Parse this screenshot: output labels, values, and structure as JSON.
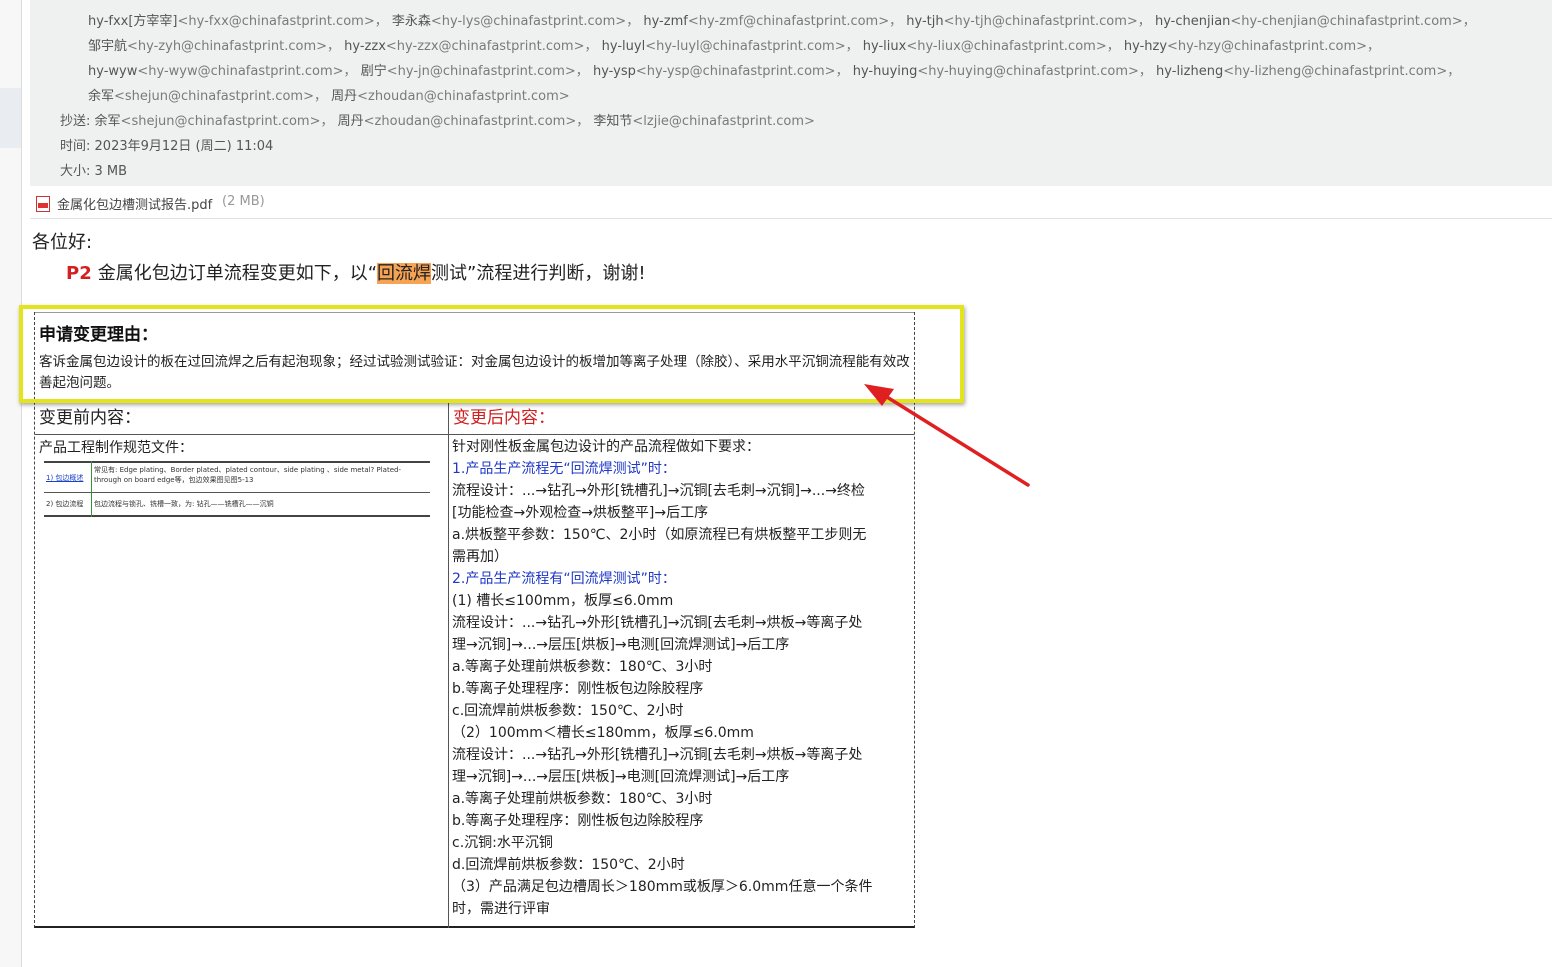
{
  "header": {
    "to_lines": [
      [
        {
          "name": "hy-fxx[方宰宰]",
          "email": "<hy-fxx@chinafastprint.com>，"
        },
        {
          "name": "李永森",
          "email": "<hy-lys@chinafastprint.com>，"
        },
        {
          "name": "hy-zmf",
          "email": "<hy-zmf@chinafastprint.com>，"
        },
        {
          "name": "hy-tjh",
          "email": "<hy-tjh@chinafastprint.com>，"
        },
        {
          "name": "hy-chenjian",
          "email": "<hy-chenjian@chinafastprint.com>，"
        }
      ],
      [
        {
          "name": "邹宇航",
          "email": "<hy-zyh@chinafastprint.com>，"
        },
        {
          "name": "hy-zzx",
          "email": "<hy-zzx@chinafastprint.com>，"
        },
        {
          "name": "hy-luyl",
          "email": "<hy-luyl@chinafastprint.com>，"
        },
        {
          "name": "hy-liux",
          "email": "<hy-liux@chinafastprint.com>，"
        },
        {
          "name": "hy-hzy",
          "email": "<hy-hzy@chinafastprint.com>，"
        }
      ],
      [
        {
          "name": "hy-wyw",
          "email": "<hy-wyw@chinafastprint.com>，"
        },
        {
          "name": "剧宁",
          "email": "<hy-jn@chinafastprint.com>，"
        },
        {
          "name": "hy-ysp",
          "email": "<hy-ysp@chinafastprint.com>，"
        },
        {
          "name": "hy-huying",
          "email": "<hy-huying@chinafastprint.com>，"
        },
        {
          "name": "hy-lizheng",
          "email": "<hy-lizheng@chinafastprint.com>，"
        }
      ],
      [
        {
          "name": "余军",
          "email": "<shejun@chinafastprint.com>，"
        },
        {
          "name": "周丹",
          "email": "<zhoudan@chinafastprint.com>"
        }
      ]
    ],
    "cc_label": "抄送:",
    "cc": [
      {
        "name": "余军",
        "email": "<shejun@chinafastprint.com>，"
      },
      {
        "name": "周丹",
        "email": "<zhoudan@chinafastprint.com>，"
      },
      {
        "name": "李知节",
        "email": "<lzjie@chinafastprint.com>"
      }
    ],
    "time_label": "时间:",
    "time_value": "2023年9月12日 (周二) 11:04",
    "size_label": "大小:",
    "size_value": "3 MB"
  },
  "attachment": {
    "name": "金属化包边槽测试报告.pdf",
    "size": "(2 MB)",
    "icon": "pdf-icon"
  },
  "body": {
    "greeting": "各位好:",
    "p2_label": "P2",
    "line_before": "金属化包边订单流程变更如下，以“",
    "highlight": "回流焊",
    "line_after": "测试”流程进行判断，谢谢!"
  },
  "table": {
    "reason_title": "申请变更理由：",
    "reason_text": "客诉金属包边设计的板在过回流焊之后有起泡现象；经过试验测试验证：对金属包边设计的板增加等离子处理（除胶）、采用水平沉铜流程能有效改善起泡问题。",
    "before_label": "变更前内容：",
    "after_label": "变更后内容：",
    "before_title": "产品工程制作规范文件：",
    "spec_image": {
      "row1_link": "1) 包边概述",
      "row1_text": "常见有: Edge plating、Border plated、plated contour、side plating 、side metal? Plated-through on board edge等，包边效果图见图5-13",
      "row2_label": "2) 包边流程",
      "row2_text": "包边流程与锁孔、铣槽一致，为: 钻孔——铣槽孔——沉铜"
    },
    "after_lines": [
      {
        "text": "针对刚性板金属包边设计的产品流程做如下要求：",
        "style": "normal"
      },
      {
        "text": "1.产品生产流程无“回流焊测试”时：",
        "style": "blue"
      },
      {
        "text": "流程设计：...→钻孔→外形[铣槽孔]→沉铜[去毛刺→沉铜]→...→终检",
        "style": "normal"
      },
      {
        "text": "[功能检查→外观检查→烘板整平]→后工序",
        "style": "normal"
      },
      {
        "text": "  a.烘板整平参数：150℃、2小时（如原流程已有烘板整平工步则无",
        "style": "normal"
      },
      {
        "text": "需再加）",
        "style": "normal"
      },
      {
        "text": "2.产品生产流程有“回流焊测试”时：",
        "style": "blue"
      },
      {
        "text": " (1) 槽长≤100mm，板厚≤6.0mm",
        "style": "normal"
      },
      {
        "text": " 流程设计：...→钻孔→外形[铣槽孔]→沉铜[去毛刺→烘板→等离子处",
        "style": "normal"
      },
      {
        "text": "理→沉铜]→...→层压[烘板]→电测[回流焊测试]→后工序",
        "style": "normal"
      },
      {
        "text": "  a.等离子处理前烘板参数：180℃、3小时",
        "style": "normal"
      },
      {
        "text": "  b.等离子处理程序：刚性板包边除胶程序",
        "style": "normal"
      },
      {
        "text": "  c.回流焊前烘板参数：150℃、2小时",
        "style": "normal"
      },
      {
        "text": "（2）100mm＜槽长≤180mm，板厚≤6.0mm",
        "style": "normal"
      },
      {
        "text": " 流程设计：...→钻孔→外形[铣槽孔]→沉铜[去毛刺→烘板→等离子处",
        "style": "normal"
      },
      {
        "text": "理→沉铜]→...→层压[烘板]→电测[回流焊测试]→后工序",
        "style": "normal"
      },
      {
        "text": "  a.等离子处理前烘板参数：180℃、3小时",
        "style": "normal"
      },
      {
        "text": "  b.等离子处理程序：刚性板包边除胶程序",
        "style": "normal"
      },
      {
        "text": "  c.沉铜:水平沉铜",
        "style": "normal"
      },
      {
        "text": "  d.回流焊前烘板参数：150℃、2小时",
        "style": "normal"
      },
      {
        "text": "（3）产品满足包边槽周长＞180mm或板厚＞6.0mm任意一个条件",
        "style": "normal"
      },
      {
        "text": "时，需进行评审",
        "style": "normal"
      }
    ]
  },
  "colors": {
    "highlight": "#f7a354",
    "annotation_box": "#e4e41c",
    "arrow": "#e02020",
    "p2": "#d31f1f",
    "after_label": "#d01f1f",
    "blue_text": "#1f38c8"
  }
}
